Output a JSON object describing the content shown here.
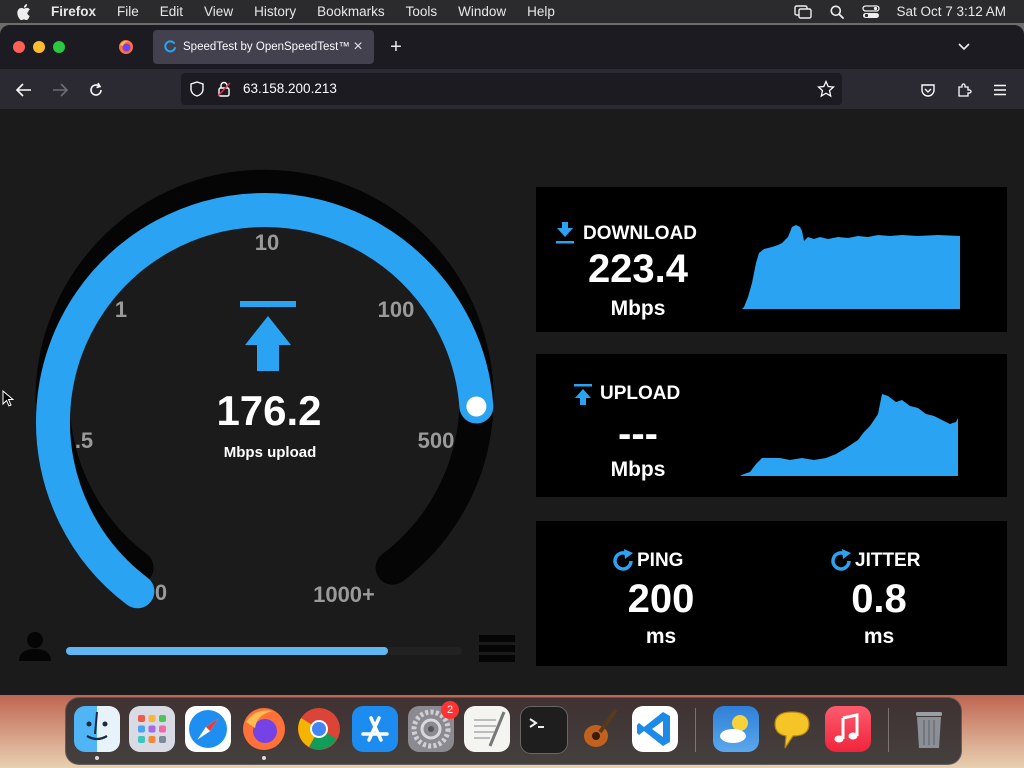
{
  "menubar": {
    "app": "Firefox",
    "items": [
      "File",
      "Edit",
      "View",
      "History",
      "Bookmarks",
      "Tools",
      "Window",
      "Help"
    ],
    "clock": "Sat Oct 7  3:12 AM"
  },
  "browser": {
    "tab_title": "SpeedTest by OpenSpeedTest™",
    "url": "63.158.200.213"
  },
  "gauge": {
    "scale_labels": [
      "0",
      ".5",
      "1",
      "10",
      "100",
      "500",
      "1000+"
    ],
    "value": "176.2",
    "unit_label": "Mbps upload",
    "progress_fraction": 0.8,
    "colors": {
      "accent": "#2aa3f2",
      "track": "#050505",
      "text": "#9a9a9a"
    }
  },
  "download": {
    "label": "DOWNLOAD",
    "value": "223.4",
    "unit": "Mbps"
  },
  "upload": {
    "label": "UPLOAD",
    "value": "---",
    "unit": "Mbps"
  },
  "ping": {
    "label": "PING",
    "value": "200",
    "unit": "ms"
  },
  "jitter": {
    "label": "JITTER",
    "value": "0.8",
    "unit": "ms"
  },
  "dock": {
    "apps": [
      "finder-icon",
      "launchpad-icon",
      "safari-icon",
      "firefox-icon",
      "chrome-icon",
      "app-store-icon",
      "system-settings-icon",
      "textedit-icon",
      "terminal-icon",
      "garageband-icon",
      "vscode-icon",
      "weather-icon",
      "feedback-icon",
      "music-icon",
      "trash-icon"
    ],
    "settings_badge": "2"
  }
}
